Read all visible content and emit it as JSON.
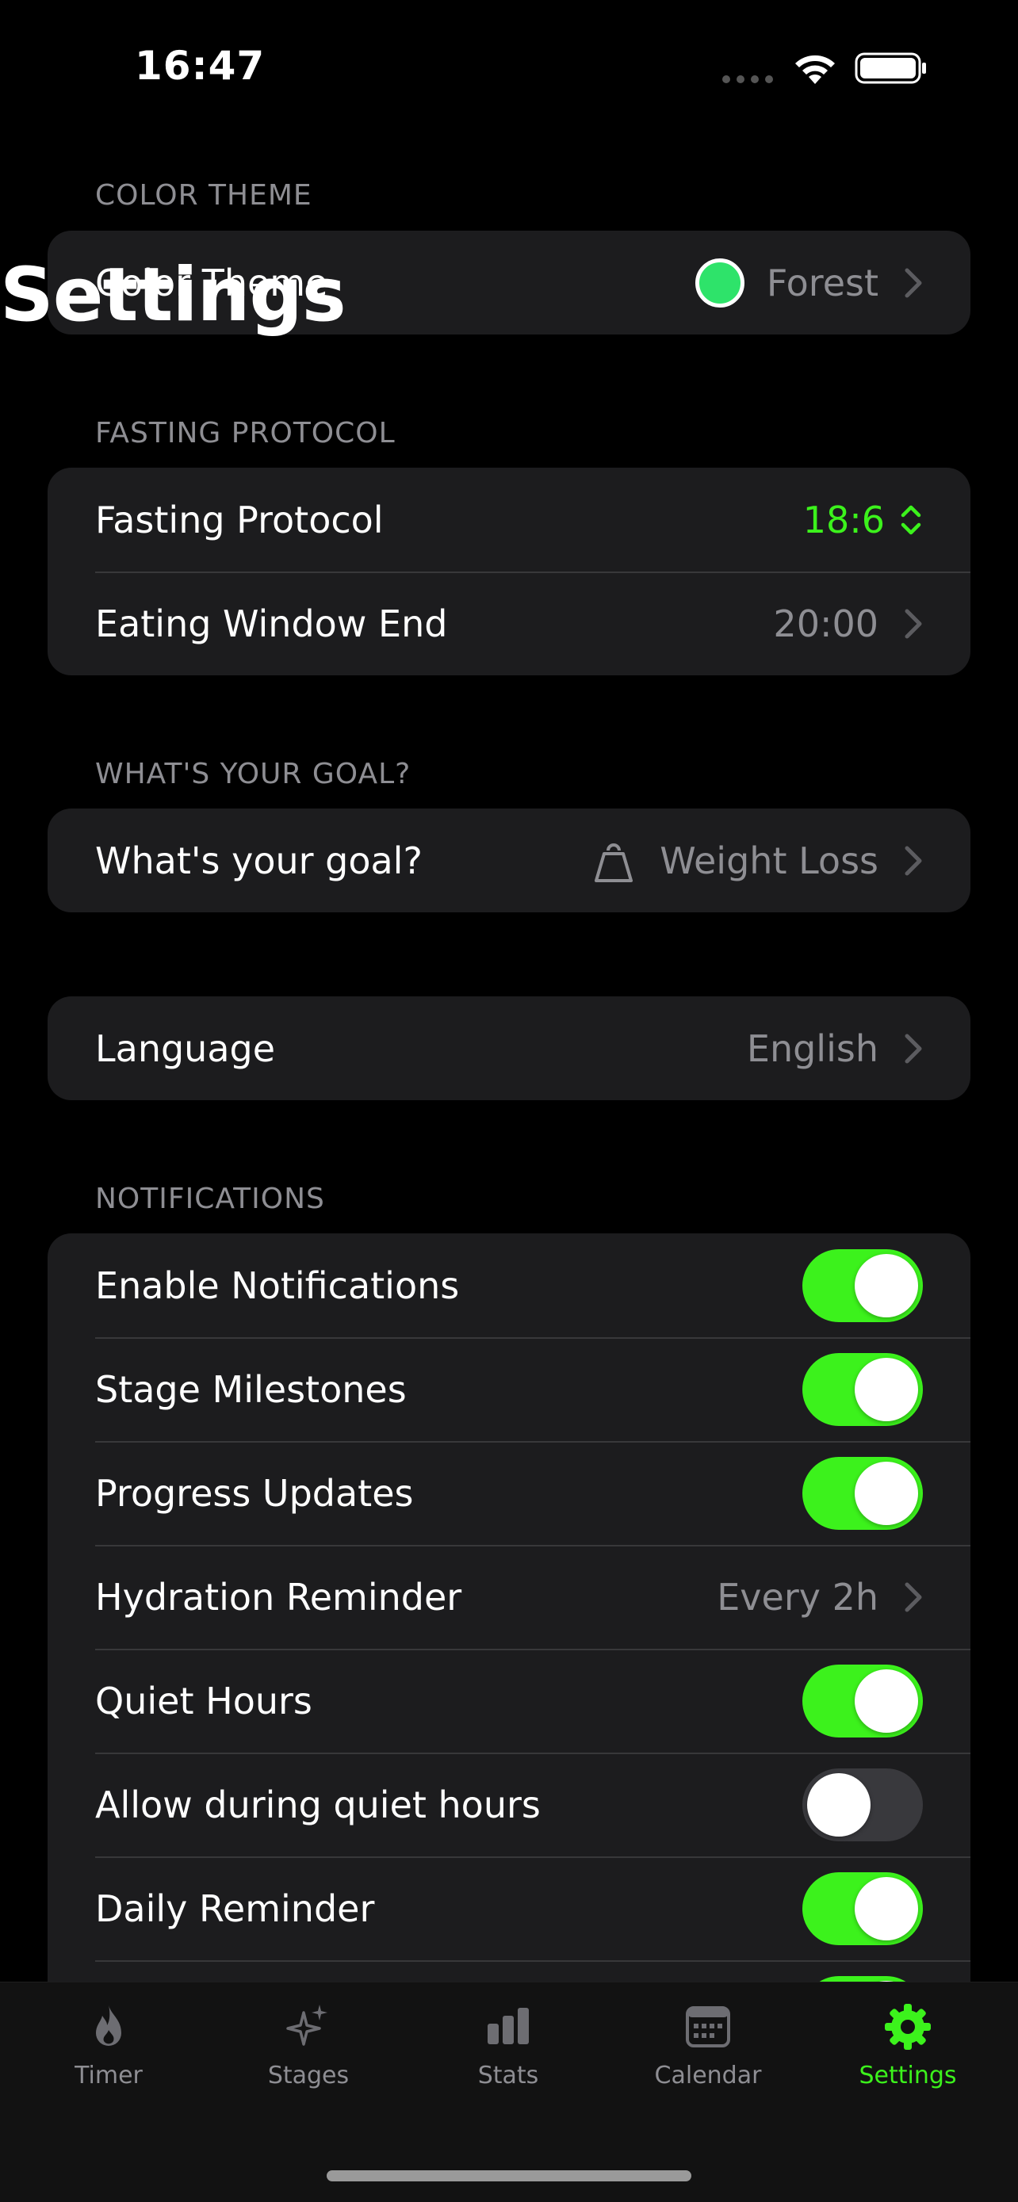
{
  "status": {
    "time": "16:47"
  },
  "nav": {
    "title": "Settings"
  },
  "colors": {
    "accent": "#3cf21c",
    "theme_dot": "#2ee36a",
    "background": "#000000",
    "card": "#1c1c1e",
    "secondary_text": "#8e8e93"
  },
  "color_theme": {
    "header": "COLOR THEME",
    "label": "Color Theme",
    "value": "Forest"
  },
  "fasting": {
    "header": "FASTING PROTOCOL",
    "protocol_label": "Fasting Protocol",
    "protocol_value": "18:6",
    "window_label": "Eating Window End",
    "window_value": "20:00"
  },
  "goal": {
    "header": "WHAT'S YOUR GOAL?",
    "label": "What's your goal?",
    "icon": "kettlebell-icon",
    "value": "Weight Loss"
  },
  "language": {
    "label": "Language",
    "value": "English"
  },
  "notifications": {
    "header": "NOTIFICATIONS",
    "items": [
      {
        "label": "Enable Notifications",
        "type": "toggle",
        "on": true
      },
      {
        "label": "Stage Milestones",
        "type": "toggle",
        "on": true
      },
      {
        "label": "Progress Updates",
        "type": "toggle",
        "on": true
      },
      {
        "label": "Hydration Reminder",
        "type": "value",
        "value": "Every 2h"
      },
      {
        "label": "Quiet Hours",
        "type": "toggle",
        "on": true
      },
      {
        "label": "Allow during quiet hours",
        "type": "toggle",
        "on": false
      },
      {
        "label": "Daily Reminder",
        "type": "toggle",
        "on": true
      }
    ]
  },
  "tabs": [
    {
      "label": "Timer",
      "icon": "flame-icon",
      "active": false
    },
    {
      "label": "Stages",
      "icon": "sparkles-icon",
      "active": false
    },
    {
      "label": "Stats",
      "icon": "bar-chart-icon",
      "active": false
    },
    {
      "label": "Calendar",
      "icon": "calendar-icon",
      "active": false
    },
    {
      "label": "Settings",
      "icon": "gear-icon",
      "active": true
    }
  ]
}
